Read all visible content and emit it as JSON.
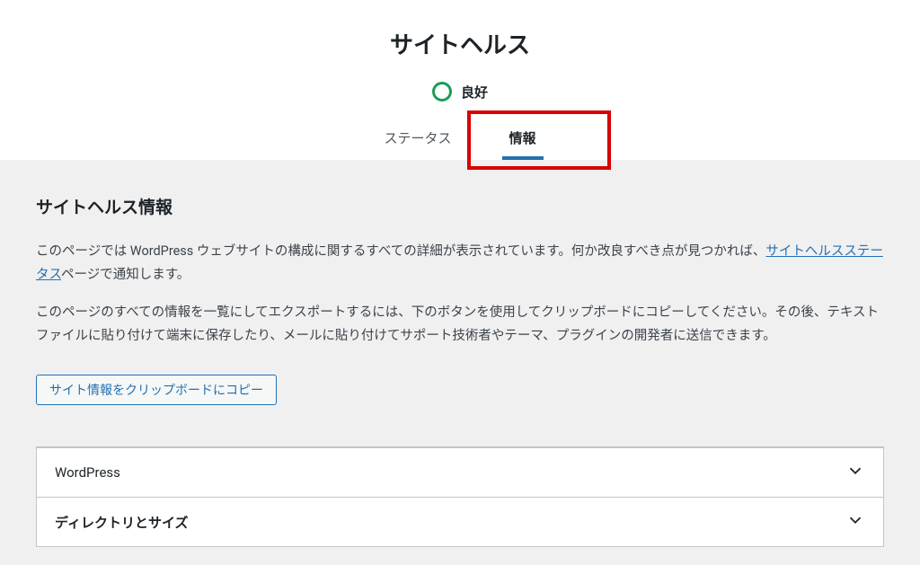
{
  "header": {
    "title": "サイトヘルス",
    "status_label": "良好"
  },
  "tabs": {
    "status": "ステータス",
    "info": "情報"
  },
  "content": {
    "section_title": "サイトヘルス情報",
    "desc1_pre": "このページでは WordPress ウェブサイトの構成に関するすべての詳細が表示されています。何か改良すべき点が見つかれば、",
    "desc1_link": "サイトヘルスステータス",
    "desc1_post": "ページで通知します。",
    "desc2": "このページのすべての情報を一覧にしてエクスポートするには、下のボタンを使用してクリップボードにコピーしてください。その後、テキストファイルに貼り付けて端末に保存したり、メールに貼り付けてサポート技術者やテーマ、プラグインの開発者に送信できます。",
    "copy_button": "サイト情報をクリップボードにコピー"
  },
  "accordion": {
    "items": [
      {
        "label": "WordPress",
        "bold": false
      },
      {
        "label": "ディレクトリとサイズ",
        "bold": true
      }
    ]
  }
}
